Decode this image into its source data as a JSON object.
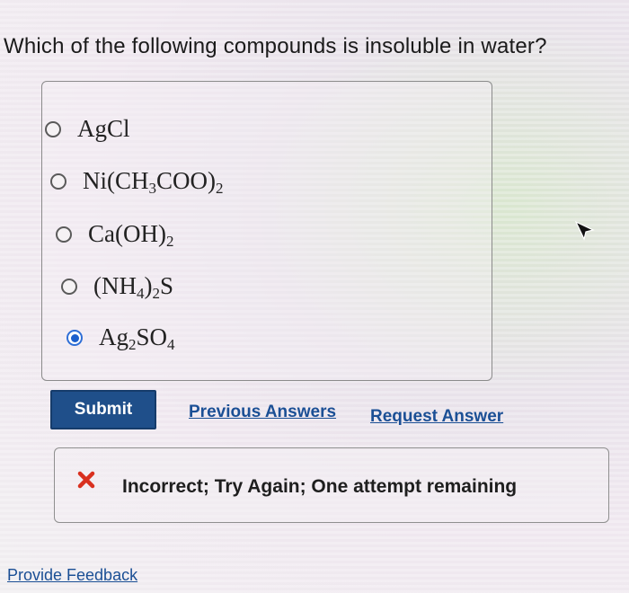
{
  "question": {
    "text": "Which of the following compounds is insoluble in water?"
  },
  "choices": [
    {
      "parts": [
        "AgCl"
      ],
      "selected": false
    },
    {
      "parts": [
        "Ni(CH",
        "3",
        "COO)",
        "2"
      ],
      "selected": false
    },
    {
      "parts": [
        "Ca(OH)",
        "2"
      ],
      "selected": false
    },
    {
      "parts": [
        "(NH",
        "4",
        ")",
        "2",
        "S"
      ],
      "selected": false
    },
    {
      "parts": [
        "Ag",
        "2",
        "SO",
        "4"
      ],
      "selected": true
    }
  ],
  "actions": {
    "submit_label": "Submit",
    "previous_answers_label": "Previous Answers",
    "request_answer_label": "Request Answer"
  },
  "feedback": {
    "message": "Incorrect; Try Again; One attempt remaining",
    "icon": "x-icon",
    "status_color": "#d9301f"
  },
  "footer": {
    "provide_feedback_label": "Provide Feedback"
  },
  "colors": {
    "submit_bg": "#1f4f8a",
    "link": "#1b4f95",
    "radio_selected": "#1b5fcc"
  }
}
